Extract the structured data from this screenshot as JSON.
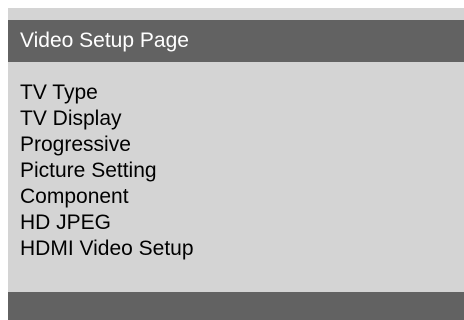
{
  "header": {
    "title": "Video Setup Page"
  },
  "menu": {
    "items": [
      {
        "label": "TV Type"
      },
      {
        "label": "TV Display"
      },
      {
        "label": "Progressive"
      },
      {
        "label": "Picture Setting"
      },
      {
        "label": "Component"
      },
      {
        "label": "HD JPEG"
      },
      {
        "label": "HDMI Video Setup"
      }
    ]
  },
  "colors": {
    "panel_background": "#d4d4d4",
    "bar_background": "#626262",
    "title_text": "#ffffff",
    "item_text": "#000000"
  }
}
